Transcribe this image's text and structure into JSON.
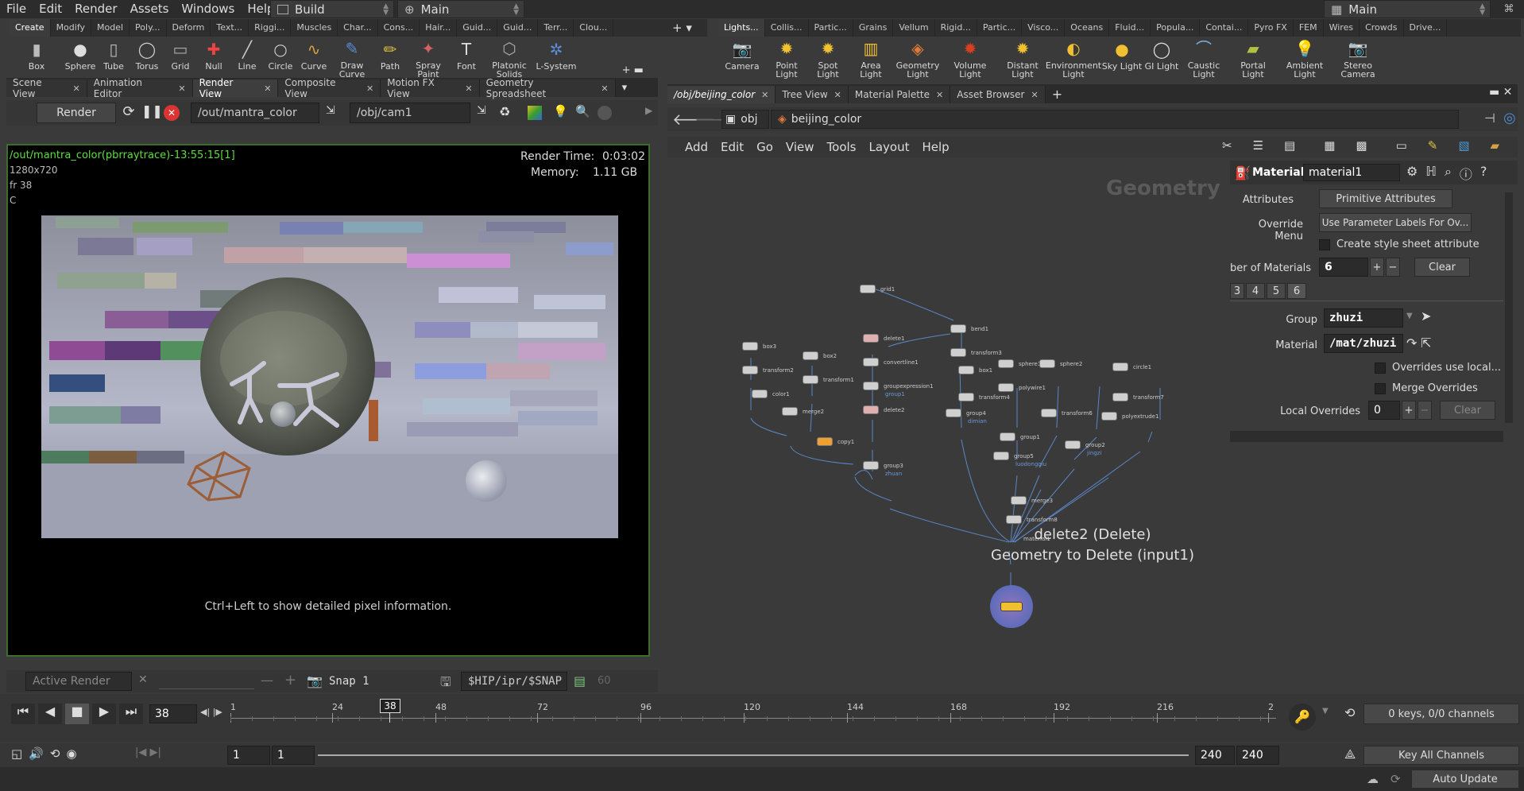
{
  "menubar": {
    "items": [
      "File",
      "Edit",
      "Render",
      "Assets",
      "Windows",
      "Help"
    ],
    "desktop": "Build",
    "context": "Main",
    "right_context": "Main"
  },
  "shelf_left": {
    "tabs": [
      "Create",
      "Modify",
      "Model",
      "Poly...",
      "Deform",
      "Text...",
      "Riggi...",
      "Muscles",
      "Char...",
      "Cons...",
      "Hair...",
      "Guid...",
      "Guid...",
      "Terr...",
      "Clou..."
    ],
    "tools": [
      "Box",
      "Sphere",
      "Tube",
      "Torus",
      "Grid",
      "Null",
      "Line",
      "Circle",
      "Curve",
      "Draw Curve",
      "Path",
      "Spray Paint",
      "Font",
      "Platonic Solids",
      "L-System"
    ]
  },
  "shelf_right": {
    "tabs": [
      "Lights...",
      "Collis...",
      "Partic...",
      "Grains",
      "Vellum",
      "Rigid...",
      "Partic...",
      "Visco...",
      "Oceans",
      "Fluid...",
      "Popula...",
      "Contai...",
      "Pyro FX",
      "FEM",
      "Wires",
      "Crowds",
      "Drive..."
    ],
    "tools": [
      "Camera",
      "Point Light",
      "Spot Light",
      "Area Light",
      "Geometry Light",
      "Volume Light",
      "Distant Light",
      "Environment Light",
      "Sky Light",
      "GI Light",
      "Caustic Light",
      "Portal Light",
      "Ambient Light",
      "Stereo Camera"
    ]
  },
  "left_pane": {
    "tabs": [
      "Scene View",
      "Animation Editor",
      "Render View",
      "Composite View",
      "Motion FX View",
      "Geometry Spreadsheet"
    ],
    "render_button": "Render",
    "rop_path": "/out/mantra_color",
    "camera_path": "/obj/cam1",
    "render_info": "/out/mantra_color(pbrraytrace)-13:55:15[1]",
    "resolution": "1280x720",
    "frame": "fr 38",
    "channel": "C",
    "render_time_label": "Render Time:",
    "render_time": "0:03:02",
    "memory_label": "Memory:",
    "memory": "1.11 GB",
    "hint": "Ctrl+Left to show detailed pixel information.",
    "active_render": "Active Render",
    "snap": "Snap 1",
    "snap_path": "$HIP/ipr/$SNAP",
    "snap_count": "60"
  },
  "right_pane": {
    "tabs": [
      "/obj/beijing_color",
      "Tree View",
      "Material Palette",
      "Asset Browser"
    ],
    "path_root": "obj",
    "path_node": "beijing_color",
    "menu": [
      "Add",
      "Edit",
      "Go",
      "View",
      "Tools",
      "Layout",
      "Help"
    ],
    "watermark": "Geometry",
    "info_title": "delete2 (Delete)",
    "info_sub": "Geometry to Delete (input1)"
  },
  "nodes": [
    {
      "label": "grid1",
      "sub": ""
    },
    {
      "label": "bend1",
      "sub": ""
    },
    {
      "label": "transform3",
      "sub": ""
    },
    {
      "label": "delete1",
      "sub": ""
    },
    {
      "label": "convertline1",
      "sub": ""
    },
    {
      "label": "groupexpression1",
      "sub": "group1"
    },
    {
      "label": "delete2",
      "sub": ""
    },
    {
      "label": "box3",
      "sub": ""
    },
    {
      "label": "transform2",
      "sub": ""
    },
    {
      "label": "color1",
      "sub": ""
    },
    {
      "label": "box2",
      "sub": ""
    },
    {
      "label": "transform1",
      "sub": ""
    },
    {
      "label": "merge2",
      "sub": ""
    },
    {
      "label": "copy1",
      "sub": ""
    },
    {
      "label": "group3",
      "sub": "zhuan"
    },
    {
      "label": "box1",
      "sub": ""
    },
    {
      "label": "transform4",
      "sub": ""
    },
    {
      "label": "group4",
      "sub": "dimian"
    },
    {
      "label": "sphere1",
      "sub": ""
    },
    {
      "label": "polywire1",
      "sub": ""
    },
    {
      "label": "sphere2",
      "sub": ""
    },
    {
      "label": "transform6",
      "sub": ""
    },
    {
      "label": "group1",
      "sub": ""
    },
    {
      "label": "group5",
      "sub": "luodongqiu"
    },
    {
      "label": "circle1",
      "sub": ""
    },
    {
      "label": "transform7",
      "sub": ""
    },
    {
      "label": "polyextrude1",
      "sub": ""
    },
    {
      "label": "group2",
      "sub": "jingzi"
    },
    {
      "label": "merge3",
      "sub": ""
    },
    {
      "label": "transform8",
      "sub": ""
    },
    {
      "label": "material1",
      "sub": ""
    }
  ],
  "params": {
    "type_label": "Material",
    "node_name": "material1",
    "attributes_label": "Attributes",
    "attributes_value": "Primitive Attributes",
    "override_label": "Override Menu",
    "override_value": "Use Parameter Labels For Ov...",
    "style_sheet": "Create style sheet attribute",
    "num_materials_label": "ber of Materials",
    "num_materials": "6",
    "clear": "Clear",
    "tabs": [
      "3",
      "4",
      "5",
      "6"
    ],
    "group_label": "Group",
    "group_value": "zhuzi",
    "material_label": "Material",
    "material_value": "/mat/zhuzi",
    "overrides_local": "Overrides use local...",
    "merge_overrides": "Merge Overrides",
    "local_overrides_label": "Local Overrides",
    "local_overrides": "0",
    "clear2": "Clear"
  },
  "timeline": {
    "current_frame": "38",
    "frame_field": "38",
    "ticks": [
      "1",
      "24",
      "48",
      "72",
      "96",
      "120",
      "144",
      "168",
      "192",
      "216",
      "2"
    ],
    "start": "1",
    "start2": "1",
    "end": "240",
    "end2": "240",
    "keys": "0 keys, 0/0 channels",
    "key_all": "Key All Channels",
    "auto_update": "Auto Update"
  }
}
